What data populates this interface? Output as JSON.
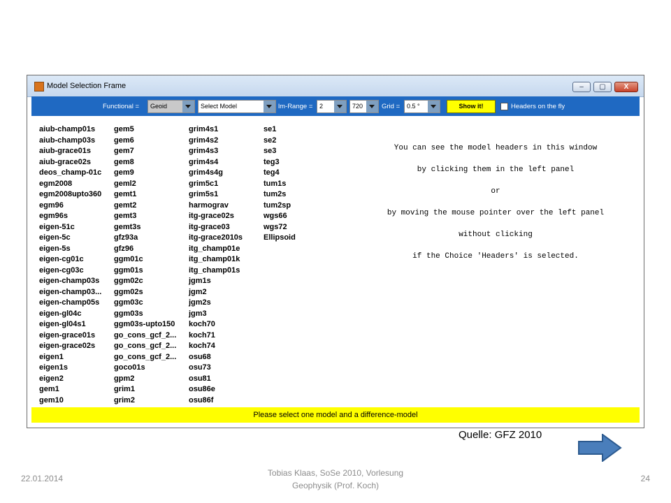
{
  "window": {
    "title": "Model Selection Frame",
    "minimize": "–",
    "maximize": "▢",
    "close": "X"
  },
  "toolbar": {
    "functional_label": "Functional =",
    "functional_value": "Geoid",
    "model_value": "Select Model",
    "lmrange_label": "lm-Range =",
    "lmrange_min": "2",
    "lmrange_max": "720",
    "grid_label": "Grid =",
    "grid_value": "0.5 °",
    "show_label": "Show it!",
    "headers_label": "Headers on the fly"
  },
  "models": {
    "col1": [
      "aiub-champ01s",
      "aiub-champ03s",
      "aiub-grace01s",
      "aiub-grace02s",
      "deos_champ-01c",
      "egm2008",
      "egm2008upto360",
      "egm96",
      "egm96s",
      "eigen-51c",
      "eigen-5c",
      "eigen-5s",
      "eigen-cg01c",
      "eigen-cg03c",
      "eigen-champ03s",
      "eigen-champ03...",
      "eigen-champ05s",
      "eigen-gl04c",
      "eigen-gl04s1",
      "eigen-grace01s",
      "eigen-grace02s",
      "eigen1",
      "eigen1s",
      "eigen2",
      "gem1",
      "gem10"
    ],
    "col2": [
      "gem5",
      "gem6",
      "gem7",
      "gem8",
      "gem9",
      "geml2",
      "gemt1",
      "gemt2",
      "gemt3",
      "gemt3s",
      "gfz93a",
      "gfz96",
      "ggm01c",
      "ggm01s",
      "ggm02c",
      "ggm02s",
      "ggm03c",
      "ggm03s",
      "ggm03s-upto150",
      "go_cons_gcf_2...",
      "go_cons_gcf_2...",
      "go_cons_gcf_2...",
      "goco01s",
      "gpm2",
      "grim1",
      "grim2"
    ],
    "col3": [
      "grim4s1",
      "grim4s2",
      "grim4s3",
      "grim4s4",
      "grim4s4g",
      "grim5c1",
      "grim5s1",
      "harmograv",
      "itg-grace02s",
      "itg-grace03",
      "itg-grace2010s",
      "itg_champ01e",
      "itg_champ01k",
      "itg_champ01s",
      "jgm1s",
      "jgm2",
      "jgm2s",
      "jgm3",
      "koch70",
      "koch71",
      "koch74",
      "osu68",
      "osu73",
      "osu81",
      "osu86e",
      "osu86f"
    ],
    "col4": [
      "se1",
      "se2",
      "se3",
      "teg3",
      "teg4",
      "tum1s",
      "tum2s",
      "tum2sp",
      "wgs66",
      "wgs72",
      "Ellipsoid"
    ]
  },
  "info_lines": [
    "You can see the model headers in this window",
    "by clicking them in the left panel",
    "or",
    "by moving the mouse pointer over the left panel",
    "without clicking",
    "if the Choice 'Headers' is selected."
  ],
  "status": "Please select one model and a difference-model",
  "slide": {
    "source": "Quelle: GFZ 2010",
    "date": "22.01.2014",
    "footer_line1": "Tobias Klaas, SoSe 2010, Vorlesung",
    "footer_line2": "Geophysik (Prof. Koch)",
    "page": "24"
  },
  "colors": {
    "toolbar": "#1f69c2",
    "highlight": "#ffff00",
    "arrow": "#4a7ebb"
  }
}
